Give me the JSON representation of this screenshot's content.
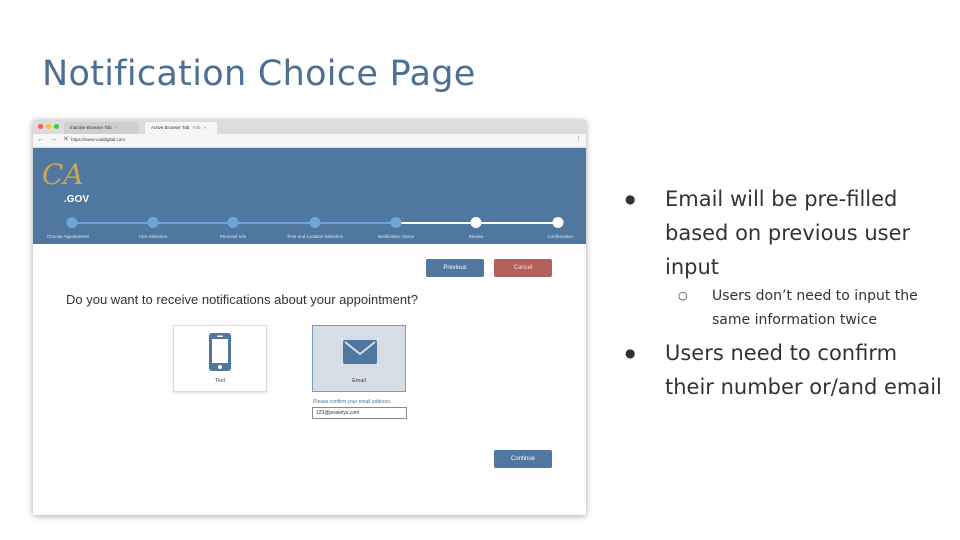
{
  "slide": {
    "title": "Notification Choice Page"
  },
  "browser": {
    "tabs": [
      {
        "label": "Inactive Browser Tab",
        "active": false
      },
      {
        "label": "Active Browser Tab",
        "active": true
      }
    ],
    "tab_extra": "Fab",
    "tab_close": "×",
    "nav_glyphs": "← → ✕",
    "url": "https://www.voaldigital.com",
    "menu": "⋮"
  },
  "app": {
    "logo_script": "CA",
    "logo_gov": ".GOV",
    "progress": {
      "completed_steps": 5,
      "steps": [
        "Choose Appointment",
        "ADA Selection",
        "Personal Info",
        "Time and Location Selection",
        "Notification choice",
        "Review",
        "Confirmation"
      ]
    },
    "buttons": {
      "previous": "Previous",
      "cancel": "Cancel",
      "continue": "Continue"
    },
    "question": "Do you want to receive notifications about your appointment?",
    "choices": {
      "text": "Text",
      "email": "Email"
    },
    "selected_choice": "Email",
    "email_prompt": "Please confirm your email address:",
    "email_value": "123@jessielyu.com",
    "colors": {
      "header": "#4f779f",
      "step_done": "#6fa3dc",
      "cancel": "#b3605a"
    }
  },
  "notes": {
    "bullet1": "Email will be pre-filled based on previous user input",
    "sub1": "Users don’t need to input the same information twice",
    "bullet2": "Users need to confirm their number or/and email"
  }
}
